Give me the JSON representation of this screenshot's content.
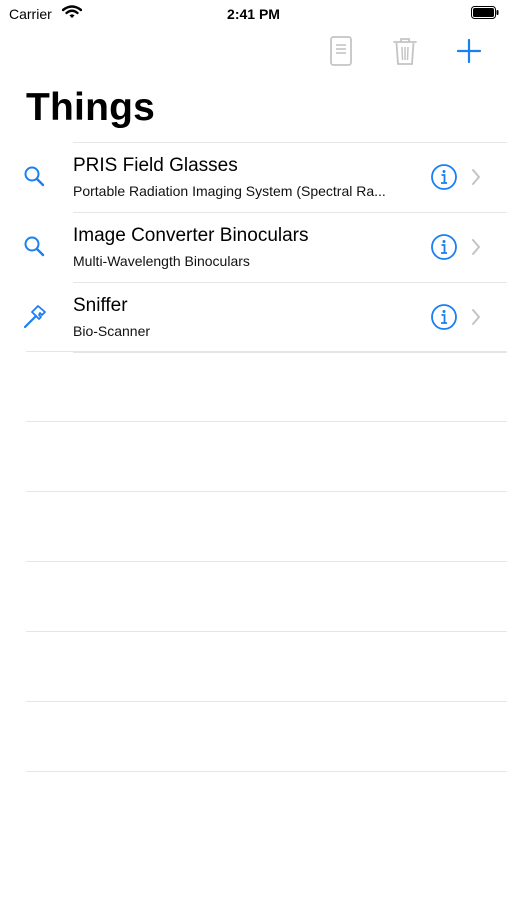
{
  "status": {
    "carrier": "Carrier",
    "time": "2:41 PM"
  },
  "toolbar": {
    "icons": [
      "document-icon",
      "trash-icon",
      "plus-icon"
    ]
  },
  "title": "Things",
  "items": [
    {
      "title": "PRIS Field Glasses",
      "subtitle": "Portable Radiation Imaging System (Spectral Ra...",
      "icon": "magnifier-icon"
    },
    {
      "title": "Image Converter Binoculars",
      "subtitle": "Multi-Wavelength Binoculars",
      "icon": "magnifier-icon"
    },
    {
      "title": "Sniffer",
      "subtitle": "Bio-Scanner",
      "icon": "hammer-icon"
    }
  ],
  "colors": {
    "accent": "#1a7ff2",
    "disabled": "#c4c4c4",
    "separator": "#e6e6e6",
    "chevron": "#c4c4c4"
  }
}
